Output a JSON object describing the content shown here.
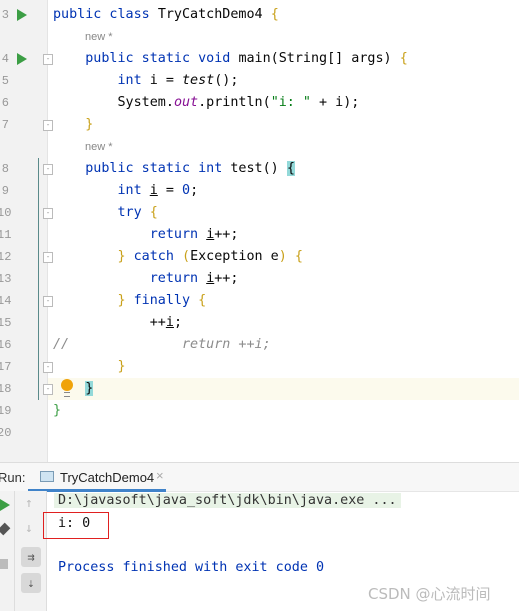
{
  "editor": {
    "hints": [
      "new *",
      "new *"
    ],
    "line_numbers": [
      "3",
      "4",
      "5",
      "6",
      "7",
      "8",
      "9",
      "10",
      "11",
      "12",
      "13",
      "14",
      "15",
      "16",
      "17",
      "18",
      "19",
      "20"
    ],
    "comment_prefix": "//"
  },
  "run_panel": {
    "label": "Run:",
    "tab": "TryCatchDemo4",
    "close": "×"
  },
  "console": {
    "command": "D:\\javasoft\\java_soft\\jdk\\bin\\java.exe ...",
    "output": "i: 0",
    "exit": "Process finished with exit code 0"
  },
  "watermark": "CSDN @心流时间"
}
